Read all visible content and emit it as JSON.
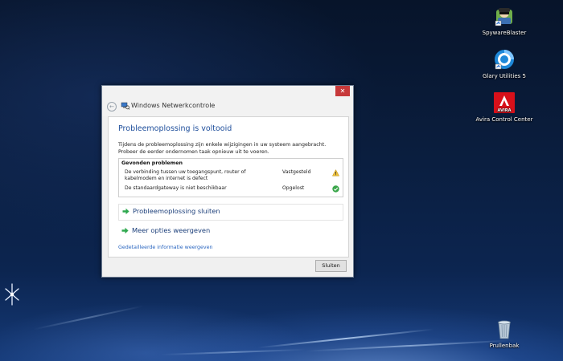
{
  "desktop": {
    "icons": [
      {
        "label": "SpywareBlaster",
        "icon": "spywareblaster-icon"
      },
      {
        "label": "Glary Utilities 5",
        "icon": "glary-utilities-icon"
      },
      {
        "label": "Avira Control Center",
        "icon": "avira-icon"
      },
      {
        "label": "Prullenbak",
        "icon": "recycle-bin-icon"
      }
    ],
    "avira_logo_text": "AVIRA"
  },
  "window": {
    "title": "Windows Netwerkcontrole",
    "close_glyph": "✕",
    "back_glyph": "←",
    "heading": "Probleemoplossing is voltooid",
    "description": "Tijdens de probleemoplossing zijn enkele wijzigingen in uw systeem aangebracht. Probeer de eerder ondernomen taak opnieuw uit te voeren.",
    "problems": {
      "header": "Gevonden problemen",
      "rows": [
        {
          "text": "De verbinding tussen uw toegangspunt, router of kabelmodem en internet is defect",
          "status": "Vastgesteld",
          "icon": "warning-icon"
        },
        {
          "text": "De standaardgateway is niet beschikbaar",
          "status": "Opgelost",
          "icon": "check-icon"
        }
      ]
    },
    "commands": [
      {
        "label": "Probleemoplossing sluiten"
      },
      {
        "label": "Meer opties weergeven"
      }
    ],
    "details_link": "Gedetailleerde informatie weergeven",
    "close_button": "Sluiten"
  },
  "colors": {
    "heading": "#1e4e9b",
    "link": "#2a66c0",
    "close": "#c7393a",
    "arrow_green": "#2fa84f"
  }
}
